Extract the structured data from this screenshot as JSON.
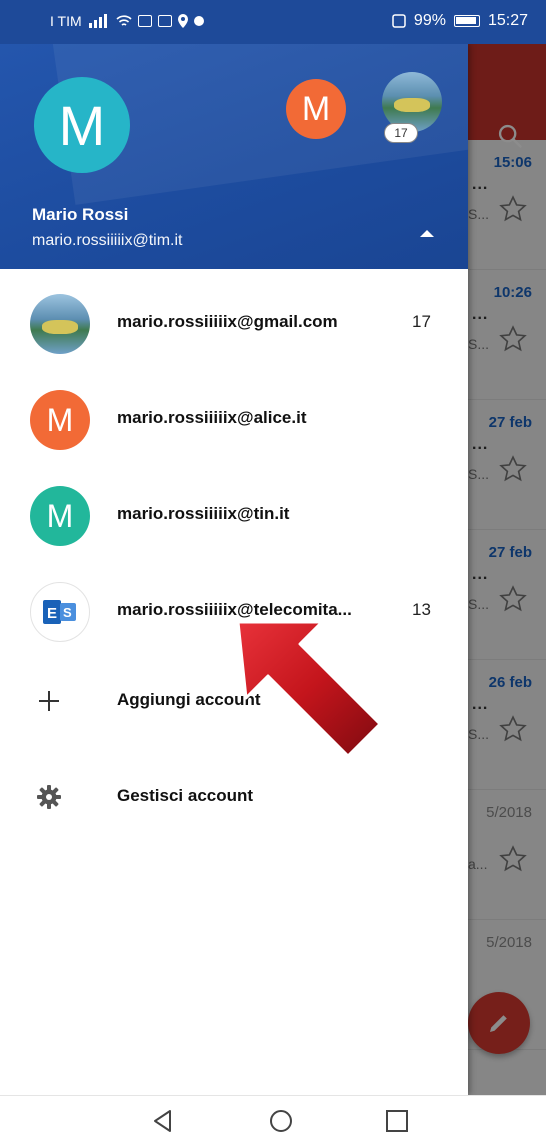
{
  "status_bar": {
    "carrier": "I TIM",
    "battery_percent": "99%",
    "time": "15:27"
  },
  "background_inbox": {
    "rows": [
      {
        "time": "15:06",
        "snippet": "S..."
      },
      {
        "time": "10:26",
        "snippet": "S..."
      },
      {
        "time": "27 feb",
        "snippet": "S..."
      },
      {
        "time": "27 feb",
        "snippet": "S..."
      },
      {
        "time": "26 feb",
        "snippet": "S..."
      },
      {
        "time": "5/2018",
        "snippet": "a..."
      },
      {
        "time": "5/2018",
        "snippet": ""
      }
    ]
  },
  "drawer": {
    "header": {
      "avatar_letter": "M",
      "secondary_avatar_letter": "M",
      "photo_badge": "17",
      "name": "Mario Rossi",
      "email": "mario.rossiiiiix@tim.it"
    },
    "accounts": [
      {
        "email": "mario.rossiiiiix@gmail.com",
        "count": "17",
        "avatar": "photo",
        "color": "#5c8fb0"
      },
      {
        "email": "mario.rossiiiiix@alice.it",
        "count": "",
        "avatar": "M",
        "color": "#f26a36"
      },
      {
        "email": "mario.rossiiiiix@tin.it",
        "count": "",
        "avatar": "M",
        "color": "#22b79b"
      },
      {
        "email": "mario.rossiiiiix@telecomita...",
        "count": "13",
        "avatar": "exchange-icon",
        "color": "#1a62b8"
      }
    ],
    "actions": {
      "add_account": "Aggiungi account",
      "manage_accounts": "Gestisci account"
    }
  },
  "colors": {
    "header_blue": "#1e4a99",
    "toolbar_red": "#c8342c",
    "fab_red": "#d83a30",
    "arrow_red": "#c4151c"
  }
}
